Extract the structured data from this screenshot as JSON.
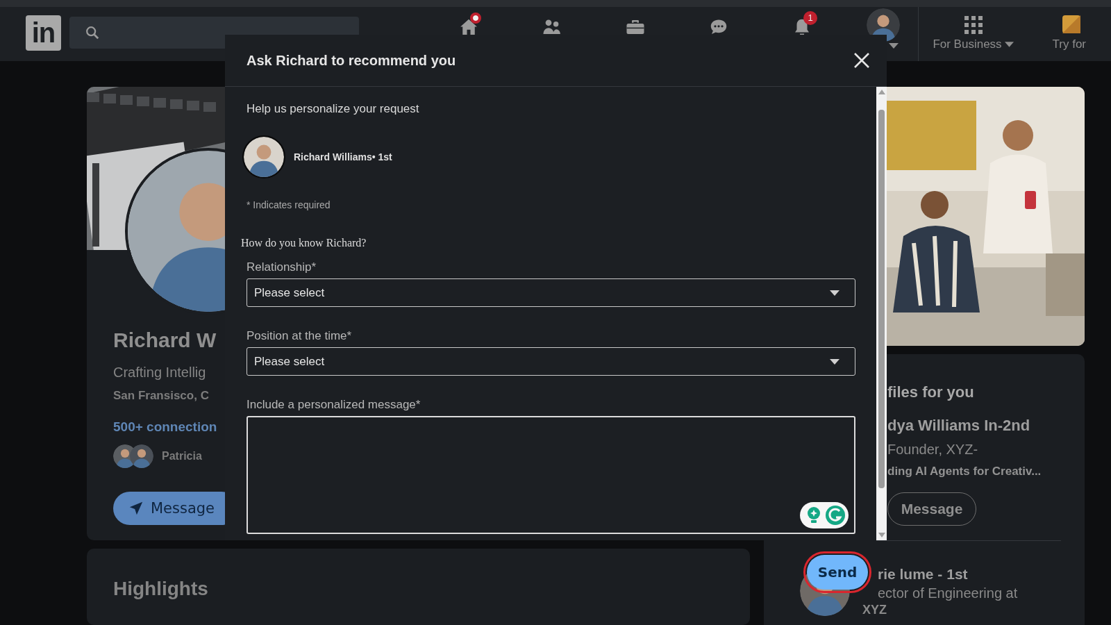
{
  "nav": {
    "logo": "in",
    "items": [
      {
        "kind": "home",
        "dot": true
      },
      {
        "kind": "network",
        "dot": false
      },
      {
        "kind": "jobs",
        "dot": false
      },
      {
        "kind": "messaging",
        "dot": false
      },
      {
        "kind": "notifications",
        "dot": false,
        "count": "1"
      }
    ],
    "business": "For Business",
    "premium": "Try for"
  },
  "profile": {
    "name": "Richard W",
    "headline": "Crafting Intellig",
    "location": "San Fransisco, C",
    "connections": "500+ connection",
    "mutual": "Patricia",
    "button": "Message"
  },
  "highlights": {
    "title": "Highlights"
  },
  "suggestions": {
    "title": "files for you",
    "people": [
      {
        "name": "dya Williams In-2nd",
        "line_1": "Founder, XYZ-",
        "line_2": "ding AI Agents for Creativ...",
        "button": "Message"
      },
      {
        "name": "rie lume - 1st",
        "line_1": "ector of Engineering at",
        "line_2": "XYZ"
      }
    ]
  },
  "modal": {
    "title": "Ask Richard to recommend you",
    "intro": "Help us personalize your request",
    "person": "Richard Williams• 1st",
    "required_note": "* Indicates required",
    "question": "How do you know Richard?",
    "fields": [
      {
        "kind": "select",
        "label": "Relationship*",
        "value": "Please select"
      },
      {
        "kind": "select",
        "label": "Position at the time*",
        "value": "Please select"
      },
      {
        "kind": "textarea",
        "label": "Include a personalized message*"
      }
    ],
    "send": {
      "label": "Send",
      "highlighted": true
    }
  }
}
